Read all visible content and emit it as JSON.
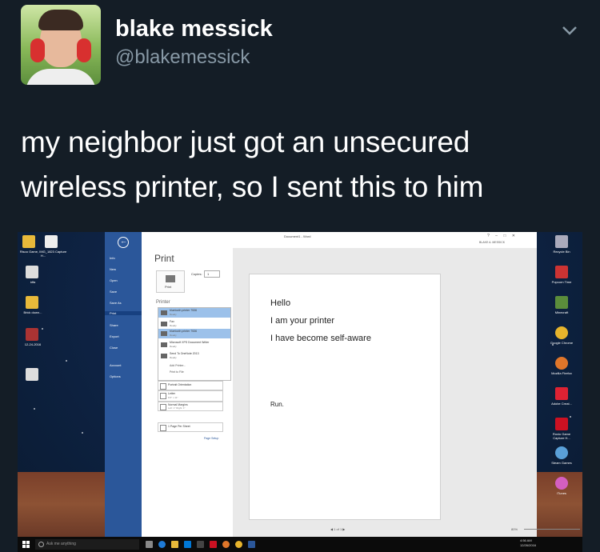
{
  "tweet": {
    "display_name": "blake messick",
    "handle": "@blakemessick",
    "text_lines": [
      "my neighbor just got an unsecured",
      "wireless printer, so I sent this to him"
    ]
  },
  "desktop": {
    "left_icons": [
      {
        "label": "Risoo Game, IMG_1823 Capture H...",
        "color": "#e8b93a"
      },
      {
        "label": "idfa",
        "color": "#dddddd"
      },
      {
        "label": "Brick down...",
        "color": "#e8b93a"
      },
      {
        "label": "12-24-2016",
        "color": "#a33"
      },
      {
        "label": "",
        "color": "#ddd"
      }
    ],
    "right_icons": [
      {
        "label": "Recycle Bin",
        "color": "#aab"
      },
      {
        "label": "Popcorn Time",
        "color": "#c33"
      },
      {
        "label": "Minecraft",
        "color": "#5b8d3b"
      },
      {
        "label": "Google Chrome",
        "color": "#e7b42c"
      },
      {
        "label": "Mozilla Firefox",
        "color": "#e0762a"
      },
      {
        "label": "Adobe Creat...",
        "color": "#d23"
      },
      {
        "label": "Roxio Game Capture H...",
        "color": "#c12"
      },
      {
        "label": "Steam Games",
        "color": "#5aa0d8"
      },
      {
        "label": "iTunes",
        "color": "#d35fc0"
      }
    ]
  },
  "word": {
    "title": "Document1 - Word",
    "user": "BLAKE A. MESSICK",
    "window_controls": "?  –  □  ✕",
    "backstage": [
      "Info",
      "New",
      "Open",
      "Save",
      "Save As",
      "Print",
      "Share",
      "Export",
      "Close",
      "Account",
      "Options"
    ],
    "active_item": "Print",
    "print_heading": "Print",
    "print_button": "Print",
    "copies_label": "Copies:",
    "copies_value": "1",
    "printer_heading": "Printer",
    "printers": [
      {
        "name": "bluetooth printer 7536",
        "status": "Ready"
      },
      {
        "name": "Fax",
        "status": "Ready"
      },
      {
        "name": "bluetooth printer 7536",
        "status": "Ready"
      },
      {
        "name": "Microsoft XPS Document Writer",
        "status": "Ready"
      },
      {
        "name": "Send To OneNote 2013",
        "status": "Ready"
      }
    ],
    "add_printer": "Add Printer...",
    "print_to_file": "Print to File",
    "settings": [
      {
        "title": "Portrait Orientation",
        "sub": ""
      },
      {
        "title": "Letter",
        "sub": "8.5\" x 11\""
      },
      {
        "title": "Normal Margins",
        "sub": "Left: 1\"  Right: 1\""
      },
      {
        "title": "1 Page Per Sheet",
        "sub": ""
      }
    ],
    "page_setup": "Page Setup",
    "preview_lines": [
      "Hello",
      "I am your printer",
      "I have become self-aware"
    ],
    "preview_run": "Run.",
    "pager": "◀  1  of 1  ▶",
    "zoom": "80%"
  },
  "taskbar": {
    "search_placeholder": "Ask me anything",
    "time": "4:56 AM",
    "date": "12/26/2016"
  }
}
